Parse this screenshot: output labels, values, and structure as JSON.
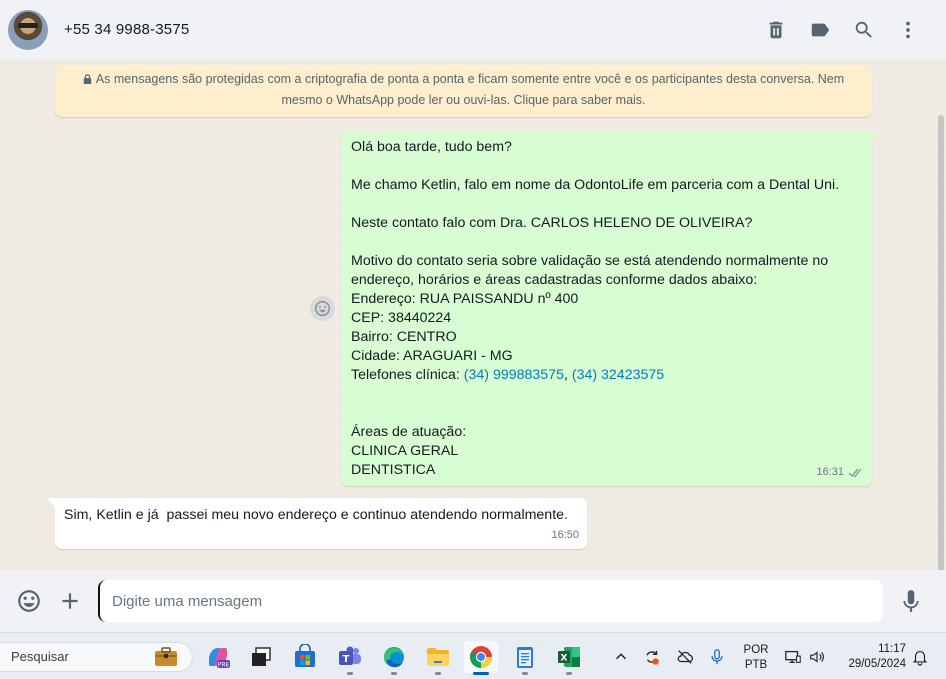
{
  "header": {
    "contact_name": "+55 34 9988-3575",
    "icons": [
      "delete-icon",
      "label-icon",
      "search-icon",
      "menu-icon"
    ]
  },
  "encryption_notice": {
    "line1": "As mensagens são protegidas com a criptografia de ponta a ponta e ficam somente entre você e os participantes desta conversa. Nem",
    "line2": "mesmo o WhatsApp pode ler ou ouvi-las. Clique para saber mais."
  },
  "messages": {
    "outgoing": {
      "lines": [
        "Olá boa tarde, tudo bem?",
        "",
        "Me chamo Ketlin, falo em nome da OdontoLife em parceria com a Dental Uni.",
        "",
        "Neste contato falo com Dra. CARLOS HELENO DE OLIVEIRA?",
        "",
        "Motivo do contato seria sobre validação se está atendendo normalmente no",
        "endereço, horários e áreas cadastradas conforme dados abaixo:",
        "Endereço: RUA PAISSANDU nº 400",
        "CEP: 38440224",
        "Bairro: CENTRO",
        "Cidade: ARAGUARI - MG"
      ],
      "phones_label": "Telefones clínica: ",
      "phone1": "(34) 999883575",
      "phone_sep": ", ",
      "phone2": "(34) 32423575",
      "tail_lines": [
        "",
        "",
        "Áreas de atuação:",
        "CLINICA GERAL",
        "DENTISTICA"
      ],
      "time": "16:31",
      "status": "read"
    },
    "incoming": {
      "text": "Sim, Ketlin e já  passei meu novo endereço e continuo atendendo normalmente.",
      "time": "16:50"
    }
  },
  "composer": {
    "placeholder": "Digite uma mensagem",
    "value": ""
  },
  "taskbar": {
    "search_label": "Pesquisar",
    "language": "POR",
    "keyboard": "PTB",
    "time": "11:17",
    "date": "29/05/2024",
    "apps": [
      "copilot",
      "task-view",
      "microsoft-store",
      "teams",
      "edge",
      "file-explorer",
      "chrome",
      "notepad",
      "excel"
    ],
    "active_app": "chrome",
    "colors": {
      "accent": "#005fb8"
    }
  },
  "colors": {
    "outgoing_bubble": "#d9fdd3",
    "incoming_bubble": "#ffffff",
    "link": "#027eb5",
    "notice_bg": "#ffeecd"
  }
}
